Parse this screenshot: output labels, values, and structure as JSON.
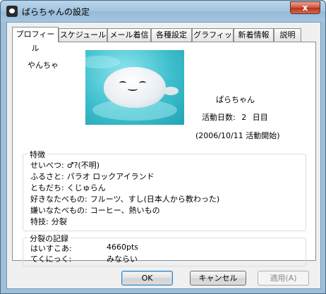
{
  "window": {
    "title": "ぱらちゃんの設定",
    "close_label": "x"
  },
  "tabs": [
    {
      "label": "プロフィール"
    },
    {
      "label": "スケジュール"
    },
    {
      "label": "メール着信"
    },
    {
      "label": "各種設定"
    },
    {
      "label": "グラフィック"
    },
    {
      "label": "新着情報"
    },
    {
      "label": "説明"
    }
  ],
  "profile": {
    "nickname": "やんちゃ",
    "name": "ぱらちゃん",
    "days_label": "活動日数:",
    "days_value": "2",
    "days_unit": "日目",
    "start_date": "(2006/10/11 活動開始)"
  },
  "traits": {
    "legend": "特徴",
    "rows": [
      {
        "label": "せいべつ:",
        "value": "♂?(不明)"
      },
      {
        "label": "ふるさと:",
        "value": "パラオ ロックアイランド"
      },
      {
        "label": "ともだち:",
        "value": "くじゅらん"
      },
      {
        "label": "好きなたべもの:",
        "value": "フルーツ、すし(日本人から教わった)"
      },
      {
        "label": "嫌いなたべもの:",
        "value": "コーヒー、熱いもの"
      },
      {
        "label": "特技:",
        "value": "分裂"
      }
    ]
  },
  "record": {
    "legend": "分裂の記録",
    "rows": [
      {
        "label": "はいすこあ:",
        "value": "4660pts"
      },
      {
        "label": "てくにっく:",
        "value": "みならい"
      }
    ]
  },
  "buttons": {
    "ok": "OK",
    "cancel": "キャンセル",
    "apply": "適用(A)"
  }
}
